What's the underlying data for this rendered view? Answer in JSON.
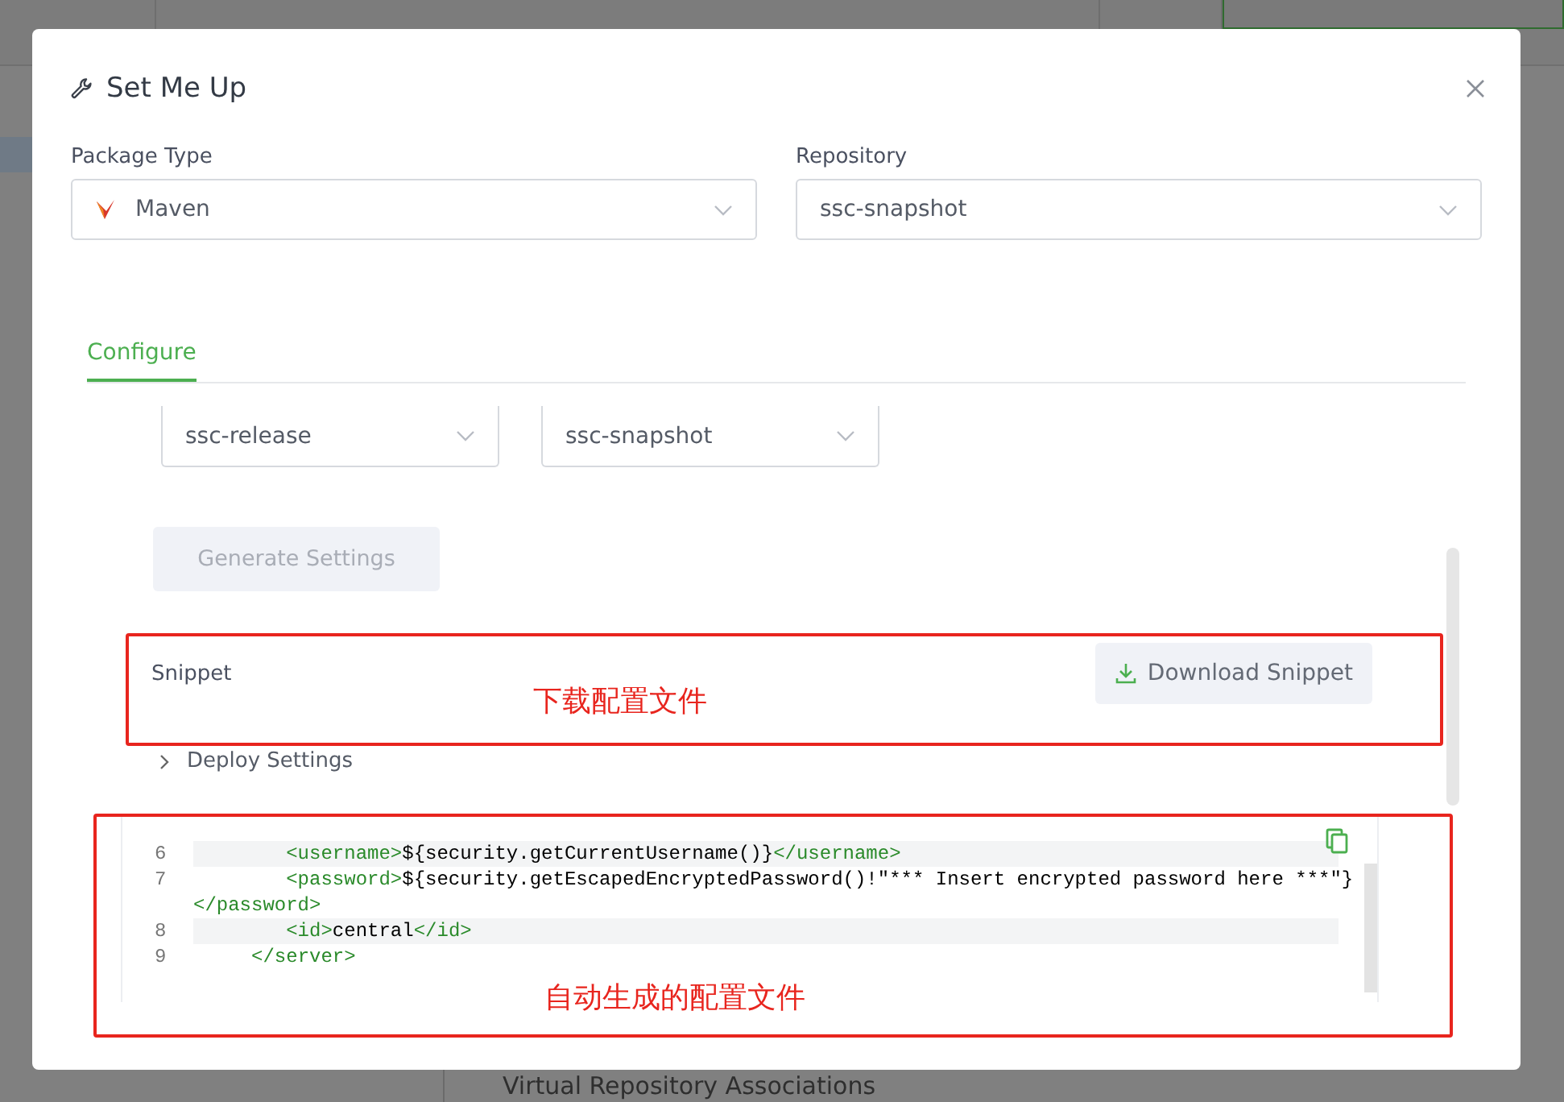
{
  "background": {
    "footer_text": "Virtual Repository Associations"
  },
  "dialog": {
    "title": "Set Me Up",
    "fields": [
      {
        "label": "Package Type",
        "value": "Maven",
        "kind": "maven"
      },
      {
        "label": "Repository",
        "value": "ssc-snapshot",
        "kind": "plain"
      }
    ],
    "tabs": [
      {
        "label": "Configure",
        "selected": true
      }
    ],
    "sub_selects": [
      {
        "value": "ssc-release"
      },
      {
        "value": "ssc-snapshot"
      }
    ],
    "generate_button": {
      "label": "Generate Settings",
      "disabled": true
    },
    "snippet": {
      "label": "Snippet",
      "button": "Download Snippet"
    },
    "deploy_settings": {
      "label": "Deploy Settings",
      "expanded": false
    },
    "code_lines": [
      {
        "number": "6",
        "highlighted": true,
        "rows": [
          "        <username>${security.getCurrentUsername()}</username>"
        ]
      },
      {
        "number": "7",
        "highlighted": false,
        "rows": [
          "        <password>${security.getEscapedEncryptedPassword()!\"*** Insert encrypted password here ***\"}",
          "</password>"
        ]
      },
      {
        "number": "8",
        "highlighted": true,
        "rows": [
          "        <id>central</id>"
        ]
      },
      {
        "number": "9",
        "highlighted": false,
        "rows": [
          "     </server>"
        ]
      }
    ]
  },
  "annotations": [
    {
      "text": "下载配置文件",
      "kind": "snippet"
    },
    {
      "text": "自动生成的配置文件",
      "kind": "code"
    }
  ]
}
